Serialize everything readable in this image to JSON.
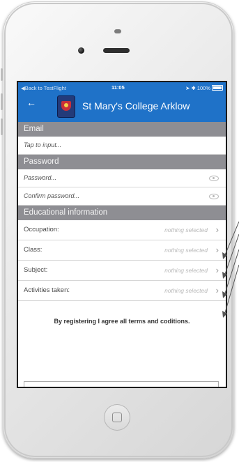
{
  "status_bar": {
    "back_label": "◀Back to TestFlight",
    "time": "11:05",
    "battery": "➤ ✱ 100%"
  },
  "header": {
    "back_icon": "arrow-left-icon",
    "title": "St Mary's College Arklow"
  },
  "email": {
    "section_label": "Email",
    "input_placeholder": "Tap to input..."
  },
  "password": {
    "section_label": "Password",
    "password_placeholder": "Password...",
    "confirm_placeholder": "Confirm password..."
  },
  "education": {
    "section_label": "Educational information",
    "fields": [
      {
        "label": "Occupation:",
        "value": "nothing selected"
      },
      {
        "label": "Class:",
        "value": "nothing selected"
      },
      {
        "label": "Subject:",
        "value": "nothing selected"
      },
      {
        "label": "Activities taken:",
        "value": "nothing selected"
      }
    ]
  },
  "terms_text": "By registering I agree all terms and coditions.",
  "colors": {
    "header_blue": "#1f72c8",
    "section_gray": "#8e8e93",
    "placeholder_gray": "#b9b9b9"
  }
}
